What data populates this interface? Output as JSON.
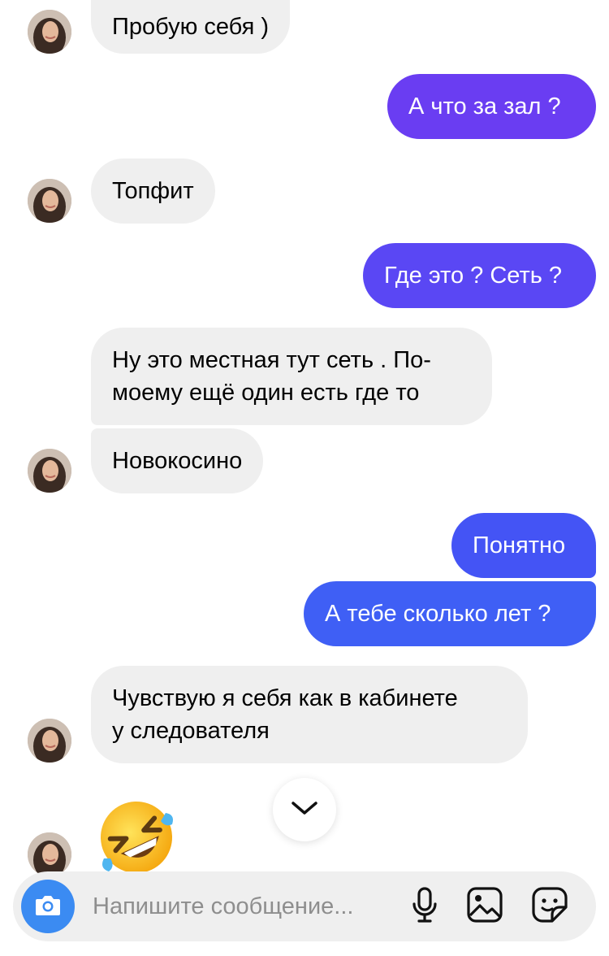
{
  "messages": [
    {
      "side": "in",
      "text": "Пробую себя )"
    },
    {
      "side": "out",
      "text": "А что за зал ?"
    },
    {
      "side": "in",
      "text": "Топфит"
    },
    {
      "side": "out",
      "text": "Где это ? Сеть ?"
    },
    {
      "side": "in",
      "lines": [
        "Ну это местная тут сеть . По-",
        "моему ещё один есть где то"
      ]
    },
    {
      "side": "in",
      "text": "Новокосино"
    },
    {
      "side": "out",
      "text": "Понятно"
    },
    {
      "side": "out",
      "text": "А тебе сколько лет ?"
    },
    {
      "side": "in",
      "lines": [
        "Чувствую я себя как в кабинете",
        "у следователя"
      ]
    },
    {
      "side": "in",
      "emoji": "rolling-on-floor-laughing"
    }
  ],
  "composer": {
    "placeholder": "Напишите сообщение..."
  },
  "icons": {
    "camera": "camera-icon",
    "mic": "microphone-icon",
    "gallery": "gallery-icon",
    "sticker": "sticker-icon",
    "scroll": "chevron-down-icon"
  },
  "colors": {
    "incoming_bubble": "#efefef",
    "outgoing_purple": "#6a3df2",
    "outgoing_blue": "#3f5ff5",
    "camera_button": "#3b8bf2"
  }
}
